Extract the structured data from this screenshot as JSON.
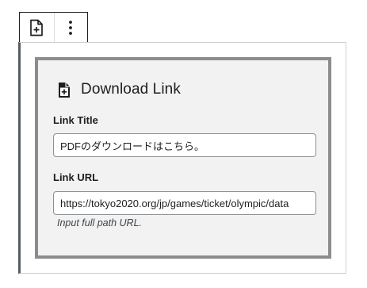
{
  "toolbar": {
    "block_icon": "file-plus-icon",
    "options_icon": "more-vertical-icon"
  },
  "block": {
    "icon": "file-plus-icon",
    "title": "Download Link",
    "link_title": {
      "label": "Link Title",
      "value": "PDFのダウンロードはこちら。"
    },
    "link_url": {
      "label": "Link URL",
      "value": "https://tokyo2020.org/jp/games/ticket/olympic/data",
      "help": "Input full path URL."
    }
  }
}
